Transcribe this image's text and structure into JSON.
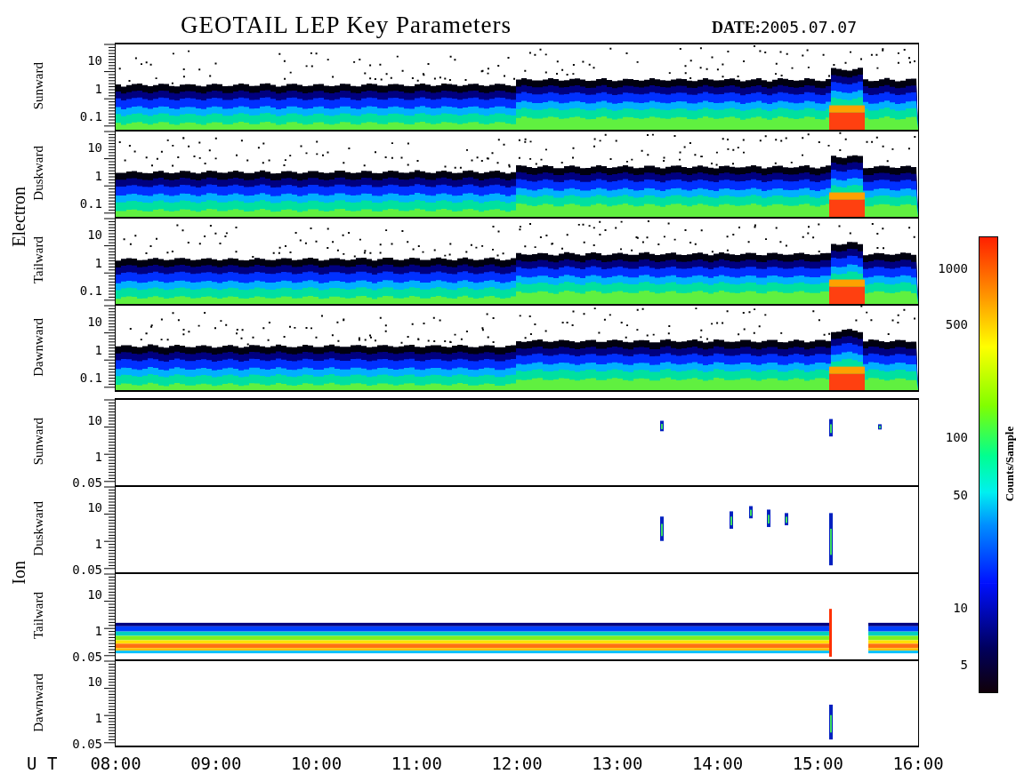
{
  "title": "GEOTAIL LEP Key Parameters",
  "date": "**DATE:**2005.07.07",
  "groups": [
    {
      "name": "Electron",
      "panels": [
        {
          "direction": "Sunward",
          "yticks": [
            "10",
            "1",
            "0.1"
          ]
        },
        {
          "direction": "Duskward",
          "yticks": [
            "10",
            "1",
            "0.1"
          ]
        },
        {
          "direction": "Tailward",
          "yticks": [
            "10",
            "1",
            "0.1"
          ]
        },
        {
          "direction": "Dawnward",
          "yticks": [
            "10",
            "1",
            "0.1"
          ]
        }
      ]
    },
    {
      "name": "Ion",
      "panels": [
        {
          "direction": "Sunward",
          "yticks": [
            "10",
            "1",
            "0.05"
          ]
        },
        {
          "direction": "Duskward",
          "yticks": [
            "10",
            "1",
            "0.05"
          ]
        },
        {
          "direction": "Tailward",
          "yticks": [
            "10",
            "1",
            "0.05"
          ]
        },
        {
          "direction": "Dawnward",
          "yticks": [
            "10",
            "1",
            "0.05"
          ]
        }
      ]
    }
  ],
  "x_axis": {
    "label": "U T",
    "ticks": [
      "08:00",
      "09:00",
      "10:00",
      "11:00",
      "12:00",
      "13:00",
      "14:00",
      "15:00",
      "16:00"
    ]
  },
  "colorbar": {
    "label": "Counts/Sample",
    "ticks": [
      "1000",
      "500",
      "100",
      "50",
      "10",
      "5"
    ]
  }
}
